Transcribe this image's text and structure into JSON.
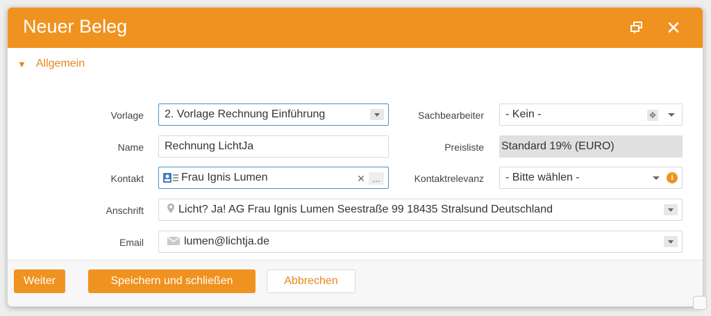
{
  "dialog": {
    "title": "Neuer Beleg",
    "restore_icon": "restore-window-icon",
    "close_icon": "close-icon"
  },
  "section": {
    "title": "Allgemein",
    "collapse_icon": "triangle-down-icon"
  },
  "form": {
    "vorlage": {
      "label": "Vorlage",
      "value": "2. Vorlage Rechnung Einführung"
    },
    "sachbearbeiter": {
      "label": "Sachbearbeiter",
      "value": "- Kein -"
    },
    "name": {
      "label": "Name",
      "value": "Rechnung LichtJa"
    },
    "preisliste": {
      "label": "Preisliste",
      "value": "Standard 19% (EURO)"
    },
    "kontakt": {
      "label": "Kontakt",
      "value": "Frau Ignis Lumen",
      "clear_label": "✕",
      "more_label": "..."
    },
    "kontaktrelevanz": {
      "label": "Kontaktrelevanz",
      "value": "- Bitte wählen -"
    },
    "anschrift": {
      "label": "Anschrift",
      "value": "Licht? Ja! AG Frau Ignis Lumen Seestraße 99 18435 Stralsund Deutschland"
    },
    "email": {
      "label": "Email",
      "value": "lumen@lichtja.de"
    }
  },
  "footer": {
    "weiter": "Weiter",
    "speichern": "Speichern und schließen",
    "abbrechen": "Abbrechen"
  },
  "colors": {
    "accent": "#f0921f",
    "focus_border": "#4a90c8"
  }
}
